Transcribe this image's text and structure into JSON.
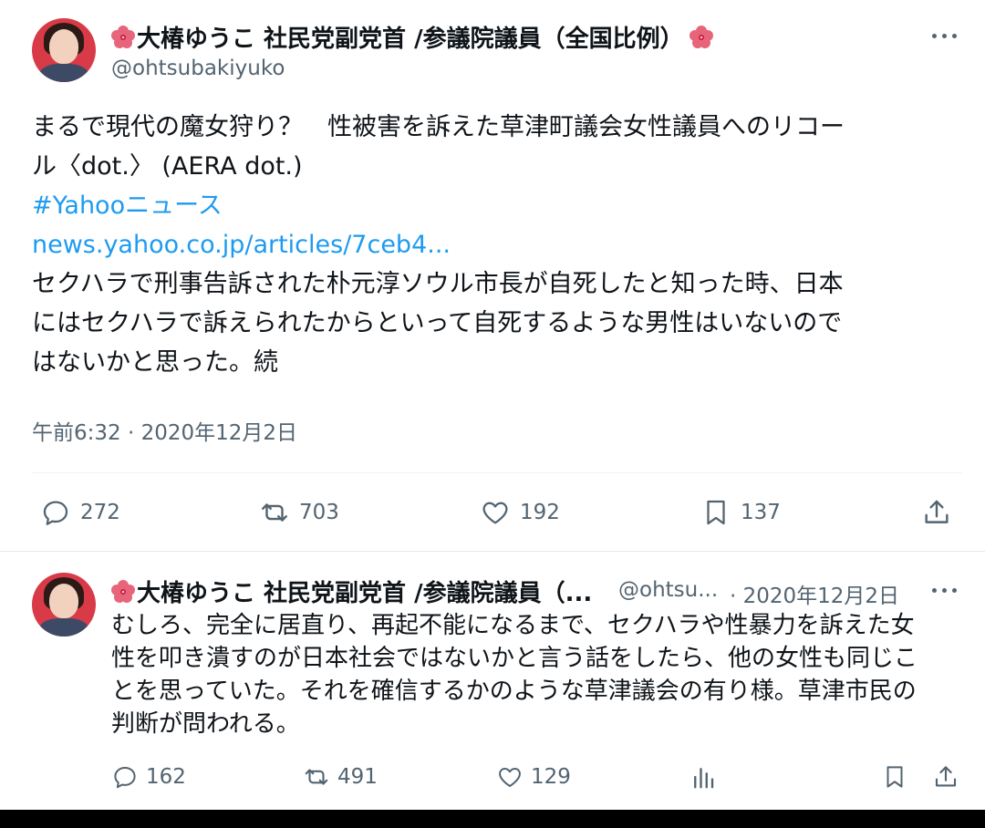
{
  "tweet1": {
    "display_name": "大椿ゆうこ 社民党副党首 /参議院議員（全国比例）",
    "handle": "@ohtsubakiyuko",
    "line1": "まるで現代の魔女狩り？　性被害を訴えた草津町議会女性議員へのリコー",
    "line2": "ル〈dot.〉 (AERA dot.)",
    "hashtag": "#Yahooニュース",
    "url": "news.yahoo.co.jp/articles/7ceb4...",
    "line3": "セクハラで刑事告訴された朴元淳ソウル市長が自死したと知った時、日本",
    "line4": "にはセクハラで訴えられたからといって自死するような男性はいないので",
    "line5": "はないかと思った。続",
    "timestamp": "午前6:32 · 2020年12月2日",
    "replies": "272",
    "retweets": "703",
    "likes": "192",
    "bookmarks": "137"
  },
  "tweet2": {
    "display_name": "大椿ゆうこ 社民党副党首 /参議院議員（...",
    "handle": "@ohtsu...",
    "date": "· 2020年12月2日",
    "line1": "むしろ、完全に居直り、再起不能になるまで、セクハラや性暴力を訴えた女",
    "line2": "性を叩き潰すのが日本社会ではないかと言う話をしたら、他の女性も同じこ",
    "line3": "とを思っていた。それを確信するかのような草津議会の有り様。草津市民の",
    "line4": "判断が問われる。",
    "replies": "162",
    "retweets": "491",
    "likes": "129"
  },
  "colors": {
    "link": "#1d9bf0",
    "secondary_text": "#536471",
    "avatar_bg": "#d83a48",
    "flower": "#e8647a"
  },
  "icons": [
    "hibiscus-icon",
    "more-icon",
    "reply-icon",
    "retweet-icon",
    "like-icon",
    "bookmark-icon",
    "share-icon",
    "views-icon"
  ]
}
